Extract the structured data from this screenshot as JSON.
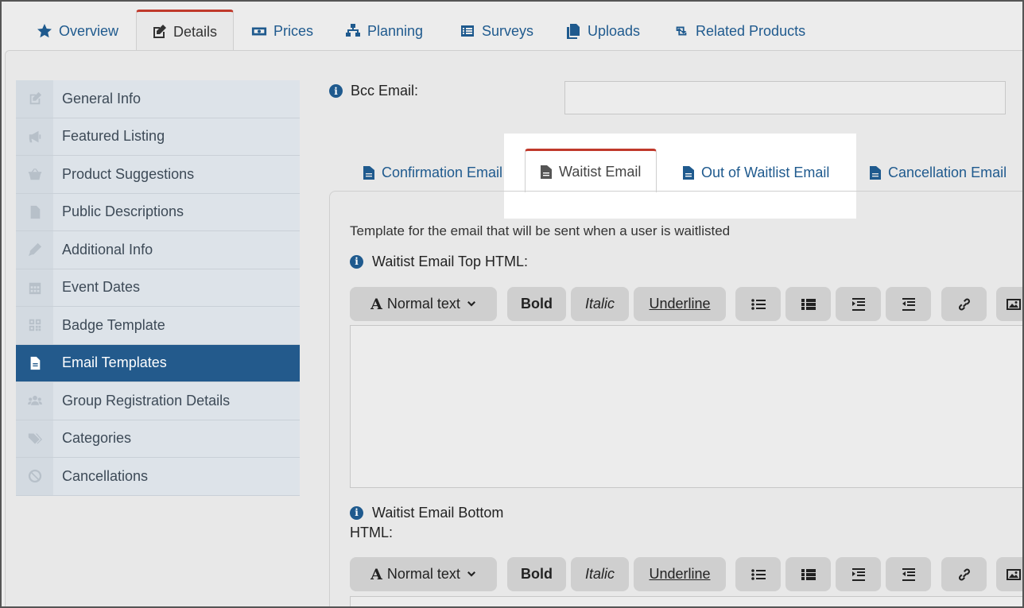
{
  "top_tabs": [
    {
      "label": "Overview",
      "icon": "star-icon"
    },
    {
      "label": "Details",
      "icon": "edit-icon",
      "active": true
    },
    {
      "label": "Prices",
      "icon": "money-icon"
    },
    {
      "label": "Planning",
      "icon": "sitemap-icon"
    },
    {
      "label": "Surveys",
      "icon": "list-icon"
    },
    {
      "label": "Uploads",
      "icon": "files-icon"
    },
    {
      "label": "Related Products",
      "icon": "retweet-icon"
    }
  ],
  "sidebar": {
    "items": [
      {
        "label": "General Info",
        "icon": "edit-icon"
      },
      {
        "label": "Featured Listing",
        "icon": "megaphone-icon"
      },
      {
        "label": "Product Suggestions",
        "icon": "basket-icon"
      },
      {
        "label": "Public Descriptions",
        "icon": "file-icon"
      },
      {
        "label": "Additional Info",
        "icon": "pencil-icon"
      },
      {
        "label": "Event Dates",
        "icon": "calendar-icon"
      },
      {
        "label": "Badge Template",
        "icon": "qrcode-icon"
      },
      {
        "label": "Email Templates",
        "icon": "file-text-icon",
        "active": true
      },
      {
        "label": "Group Registration Details",
        "icon": "users-icon"
      },
      {
        "label": "Categories",
        "icon": "tags-icon"
      },
      {
        "label": "Cancellations",
        "icon": "ban-icon"
      }
    ]
  },
  "bcc": {
    "label": "Bcc Email:",
    "value": ""
  },
  "email_tabs": [
    {
      "label": "Confirmation Email"
    },
    {
      "label": "Waitist Email",
      "active": true
    },
    {
      "label": "Out of Waitlist Email"
    },
    {
      "label": "Cancellation Email"
    }
  ],
  "editor": {
    "description": "Template for the email that will be sent when a user is waitlisted",
    "top_label": "Waitist Email Top HTML:",
    "bottom_label_line1": "Waitist Email Bottom",
    "bottom_label_line2": "HTML:",
    "toolbar": {
      "format": "Normal text",
      "bold": "Bold",
      "italic": "Italic",
      "underline": "Underline"
    }
  },
  "colors": {
    "accent": "#1f5a8e",
    "active_tab_border": "#c0392b",
    "sidebar_active": "#235a8c"
  }
}
